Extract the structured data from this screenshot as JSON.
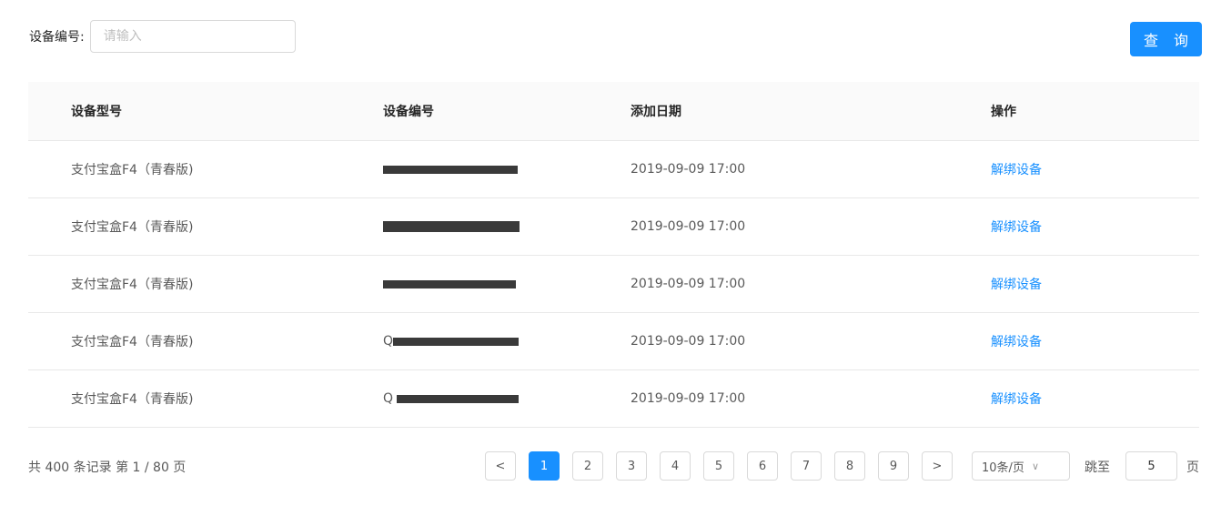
{
  "search": {
    "label": "设备编号:",
    "placeholder": "请输入",
    "value": ""
  },
  "query_button": "查 询",
  "table": {
    "headers": [
      "设备型号",
      "设备编号",
      "添加日期",
      "操作"
    ],
    "rows": [
      {
        "model": "支付宝盒F4（青春版)",
        "serial": "",
        "date": "2019-09-09 17:00",
        "action": "解绑设备"
      },
      {
        "model": "支付宝盒F4（青春版)",
        "serial": "",
        "date": "2019-09-09 17:00",
        "action": "解绑设备"
      },
      {
        "model": "支付宝盒F4（青春版)",
        "serial": "",
        "date": "2019-09-09 17:00",
        "action": "解绑设备"
      },
      {
        "model": "支付宝盒F4（青春版)",
        "serial": "Q",
        "date": "2019-09-09 17:00",
        "action": "解绑设备"
      },
      {
        "model": "支付宝盒F4（青春版)",
        "serial": "Q",
        "date": "2019-09-09 17:00",
        "action": "解绑设备"
      }
    ]
  },
  "pagination": {
    "summary": "共 400 条记录 第 1 / 80 页",
    "prev": "<",
    "next": ">",
    "pages": [
      "1",
      "2",
      "3",
      "4",
      "5",
      "6",
      "7",
      "8",
      "9"
    ],
    "active_page": "1",
    "page_size": "10条/页",
    "jump_label": "跳至",
    "jump_value": "5",
    "page_unit": "页"
  },
  "colors": {
    "primary": "#1890ff",
    "header_bg": "#fafafa",
    "border": "#e8e8e8",
    "redaction": "#3a3a3a"
  }
}
